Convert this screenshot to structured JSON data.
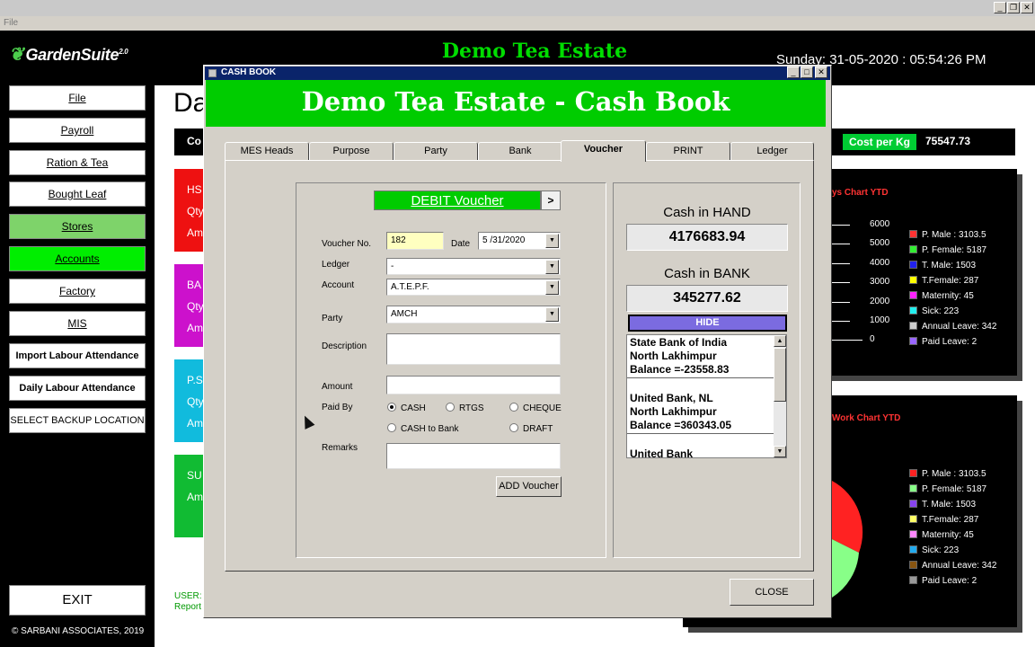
{
  "window": {
    "menu_file": "File"
  },
  "app": {
    "logo_text": "GardenSuite",
    "logo_version": "2.0",
    "estate_title": "Demo Tea Estate",
    "datetime": "Sunday: 31-05-2020 : 05:54:26 PM",
    "copyright": "© SARBANI ASSOCIATES, 2019",
    "exit_label": "EXIT"
  },
  "sidebar": {
    "items": [
      {
        "label": "File"
      },
      {
        "label": "Payroll"
      },
      {
        "label": "Ration & Tea"
      },
      {
        "label": "Bought Leaf"
      },
      {
        "label": "Stores"
      },
      {
        "label": "Accounts"
      },
      {
        "label": "Factory"
      },
      {
        "label": "MIS"
      },
      {
        "label": "Import Labour Attendance"
      },
      {
        "label": "Daily Labour Attendance"
      },
      {
        "label": "SELECT BACKUP LOCATION"
      }
    ]
  },
  "dashboard": {
    "title_fragment": "Da",
    "cost_bar_fragment": "Co",
    "cost_label": "Cost per Kg",
    "cost_value": "75547.73",
    "cards": [
      {
        "title": "HS",
        "line1": "Qty",
        "line2": "Am",
        "color": "#ee1111"
      },
      {
        "title": "BA",
        "line1": "Qty",
        "line2": "Am",
        "color": "#cc11cc"
      },
      {
        "title": "P.S",
        "line1": "Qty",
        "line2": "Am",
        "color": "#11bbdd"
      },
      {
        "title": "SU",
        "line1": "",
        "line2": "Am",
        "color": "#11bb33"
      }
    ],
    "chart1_title": "ys Chart YTD",
    "chart2_title": "Work Chart YTD",
    "user_fragment": "USER:",
    "report_fragment": "Report"
  },
  "chart_data": [
    {
      "type": "bar",
      "title": "ys Chart YTD",
      "ylim": [
        0,
        6000
      ],
      "yticks": [
        "6000",
        "5000",
        "4000",
        "3000",
        "2000",
        "1000",
        "0"
      ],
      "series": [
        {
          "name": "P. Male : 3103.5",
          "color": "#ff3333"
        },
        {
          "name": "P. Female: 5187",
          "color": "#33ee33"
        },
        {
          "name": "T. Male: 1503",
          "color": "#2222ee"
        },
        {
          "name": "T.Female: 287",
          "color": "#ffff00"
        },
        {
          "name": "Maternity: 45",
          "color": "#ff22ff"
        },
        {
          "name": "Sick: 223",
          "color": "#22eeee"
        },
        {
          "name": "Annual Leave: 342",
          "color": "#cccccc"
        },
        {
          "name": "Paid Leave: 2",
          "color": "#9966ff"
        }
      ],
      "legend": "right"
    },
    {
      "type": "pie",
      "title": "Work Chart YTD",
      "series": [
        {
          "name": "P. Male : 3103.5",
          "color": "#ff2222"
        },
        {
          "name": "P. Female: 5187",
          "color": "#88ff88"
        },
        {
          "name": "T. Male: 1503",
          "color": "#8844ee"
        },
        {
          "name": "T.Female: 287",
          "color": "#ffff66"
        },
        {
          "name": "Maternity: 45",
          "color": "#ff88ff"
        },
        {
          "name": "Sick: 223",
          "color": "#22aaee"
        },
        {
          "name": "Annual Leave: 342",
          "color": "#885511"
        },
        {
          "name": "Paid Leave: 2",
          "color": "#999999"
        }
      ],
      "legend": "right"
    }
  ],
  "dialog": {
    "title": "CASH BOOK",
    "banner": "Demo Tea Estate - Cash Book",
    "tabs": [
      {
        "label": "MES Heads"
      },
      {
        "label": "Purpose"
      },
      {
        "label": "Party"
      },
      {
        "label": "Bank"
      },
      {
        "label": "Voucher"
      },
      {
        "label": "PRINT"
      },
      {
        "label": "Ledger"
      }
    ],
    "voucher_type": "DEBIT Voucher",
    "voucher_next": ">",
    "form": {
      "voucher_no_label": "Voucher No.",
      "voucher_no_value": "182",
      "date_label": "Date",
      "date_value": "5 /31/2020",
      "ledger_label": "Ledger",
      "ledger_value": "-",
      "account_label": "Account",
      "account_value": "A.T.E.P.F.",
      "party_label": "Party",
      "party_value": "AMCH",
      "description_label": "Description",
      "description_value": "",
      "amount_label": "Amount",
      "amount_value": "",
      "paid_by_label": "Paid By",
      "paid_by_options": [
        {
          "label": "CASH",
          "selected": true
        },
        {
          "label": "RTGS",
          "selected": false
        },
        {
          "label": "CHEQUE",
          "selected": false
        },
        {
          "label": "CASH to Bank",
          "selected": false
        },
        {
          "label": "DRAFT",
          "selected": false
        }
      ],
      "remarks_label": "Remarks",
      "remarks_value": "",
      "add_button": "ADD Voucher"
    },
    "cash": {
      "hand_label": "Cash in HAND",
      "hand_value": "4176683.94",
      "bank_label": "Cash in BANK",
      "bank_value": "345277.62",
      "hide_button": "HIDE",
      "banks": [
        {
          "name": "State Bank of India",
          "branch": "North Lakhimpur",
          "balance": "Balance =-23558.83"
        },
        {
          "name": "United Bank, NL",
          "branch": "North Lakhimpur",
          "balance": "Balance =360343.05"
        },
        {
          "name": "United Bank",
          "branch": "",
          "balance": ""
        }
      ]
    },
    "close_button": "CLOSE"
  }
}
